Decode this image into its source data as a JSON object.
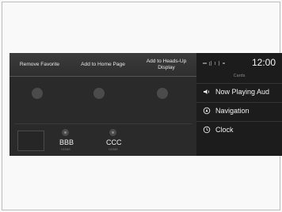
{
  "popup": {
    "options": [
      "Remove Favorite",
      "Add to Home Page",
      "Add to Heads-Up Display"
    ]
  },
  "status": {
    "time": "12:00"
  },
  "cards": {
    "title": "Cards",
    "items": [
      {
        "label": "Now Playing Aud",
        "icon": "speaker-icon"
      },
      {
        "label": "Navigation",
        "icon": "navigation-icon"
      },
      {
        "label": "Clock",
        "icon": "clock-icon"
      }
    ]
  },
  "presets": [
    {
      "name": "BBB",
      "sub": "HOME"
    },
    {
      "name": "CCC",
      "sub": "HOME"
    }
  ]
}
